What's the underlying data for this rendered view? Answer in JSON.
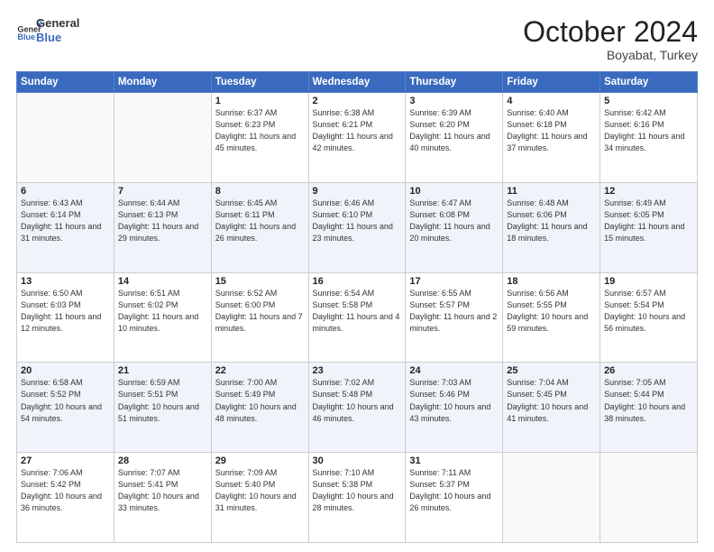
{
  "header": {
    "logo_line1": "General",
    "logo_line2": "Blue",
    "month": "October 2024",
    "location": "Boyabat, Turkey"
  },
  "days_of_week": [
    "Sunday",
    "Monday",
    "Tuesday",
    "Wednesday",
    "Thursday",
    "Friday",
    "Saturday"
  ],
  "weeks": [
    [
      {
        "day": "",
        "empty": true
      },
      {
        "day": "",
        "empty": true
      },
      {
        "day": "1",
        "sunrise": "6:37 AM",
        "sunset": "6:23 PM",
        "daylight": "11 hours and 45 minutes."
      },
      {
        "day": "2",
        "sunrise": "6:38 AM",
        "sunset": "6:21 PM",
        "daylight": "11 hours and 42 minutes."
      },
      {
        "day": "3",
        "sunrise": "6:39 AM",
        "sunset": "6:20 PM",
        "daylight": "11 hours and 40 minutes."
      },
      {
        "day": "4",
        "sunrise": "6:40 AM",
        "sunset": "6:18 PM",
        "daylight": "11 hours and 37 minutes."
      },
      {
        "day": "5",
        "sunrise": "6:42 AM",
        "sunset": "6:16 PM",
        "daylight": "11 hours and 34 minutes."
      }
    ],
    [
      {
        "day": "6",
        "sunrise": "6:43 AM",
        "sunset": "6:14 PM",
        "daylight": "11 hours and 31 minutes."
      },
      {
        "day": "7",
        "sunrise": "6:44 AM",
        "sunset": "6:13 PM",
        "daylight": "11 hours and 29 minutes."
      },
      {
        "day": "8",
        "sunrise": "6:45 AM",
        "sunset": "6:11 PM",
        "daylight": "11 hours and 26 minutes."
      },
      {
        "day": "9",
        "sunrise": "6:46 AM",
        "sunset": "6:10 PM",
        "daylight": "11 hours and 23 minutes."
      },
      {
        "day": "10",
        "sunrise": "6:47 AM",
        "sunset": "6:08 PM",
        "daylight": "11 hours and 20 minutes."
      },
      {
        "day": "11",
        "sunrise": "6:48 AM",
        "sunset": "6:06 PM",
        "daylight": "11 hours and 18 minutes."
      },
      {
        "day": "12",
        "sunrise": "6:49 AM",
        "sunset": "6:05 PM",
        "daylight": "11 hours and 15 minutes."
      }
    ],
    [
      {
        "day": "13",
        "sunrise": "6:50 AM",
        "sunset": "6:03 PM",
        "daylight": "11 hours and 12 minutes."
      },
      {
        "day": "14",
        "sunrise": "6:51 AM",
        "sunset": "6:02 PM",
        "daylight": "11 hours and 10 minutes."
      },
      {
        "day": "15",
        "sunrise": "6:52 AM",
        "sunset": "6:00 PM",
        "daylight": "11 hours and 7 minutes."
      },
      {
        "day": "16",
        "sunrise": "6:54 AM",
        "sunset": "5:58 PM",
        "daylight": "11 hours and 4 minutes."
      },
      {
        "day": "17",
        "sunrise": "6:55 AM",
        "sunset": "5:57 PM",
        "daylight": "11 hours and 2 minutes."
      },
      {
        "day": "18",
        "sunrise": "6:56 AM",
        "sunset": "5:55 PM",
        "daylight": "10 hours and 59 minutes."
      },
      {
        "day": "19",
        "sunrise": "6:57 AM",
        "sunset": "5:54 PM",
        "daylight": "10 hours and 56 minutes."
      }
    ],
    [
      {
        "day": "20",
        "sunrise": "6:58 AM",
        "sunset": "5:52 PM",
        "daylight": "10 hours and 54 minutes."
      },
      {
        "day": "21",
        "sunrise": "6:59 AM",
        "sunset": "5:51 PM",
        "daylight": "10 hours and 51 minutes."
      },
      {
        "day": "22",
        "sunrise": "7:00 AM",
        "sunset": "5:49 PM",
        "daylight": "10 hours and 48 minutes."
      },
      {
        "day": "23",
        "sunrise": "7:02 AM",
        "sunset": "5:48 PM",
        "daylight": "10 hours and 46 minutes."
      },
      {
        "day": "24",
        "sunrise": "7:03 AM",
        "sunset": "5:46 PM",
        "daylight": "10 hours and 43 minutes."
      },
      {
        "day": "25",
        "sunrise": "7:04 AM",
        "sunset": "5:45 PM",
        "daylight": "10 hours and 41 minutes."
      },
      {
        "day": "26",
        "sunrise": "7:05 AM",
        "sunset": "5:44 PM",
        "daylight": "10 hours and 38 minutes."
      }
    ],
    [
      {
        "day": "27",
        "sunrise": "7:06 AM",
        "sunset": "5:42 PM",
        "daylight": "10 hours and 36 minutes."
      },
      {
        "day": "28",
        "sunrise": "7:07 AM",
        "sunset": "5:41 PM",
        "daylight": "10 hours and 33 minutes."
      },
      {
        "day": "29",
        "sunrise": "7:09 AM",
        "sunset": "5:40 PM",
        "daylight": "10 hours and 31 minutes."
      },
      {
        "day": "30",
        "sunrise": "7:10 AM",
        "sunset": "5:38 PM",
        "daylight": "10 hours and 28 minutes."
      },
      {
        "day": "31",
        "sunrise": "7:11 AM",
        "sunset": "5:37 PM",
        "daylight": "10 hours and 26 minutes."
      },
      {
        "day": "",
        "empty": true
      },
      {
        "day": "",
        "empty": true
      }
    ]
  ]
}
